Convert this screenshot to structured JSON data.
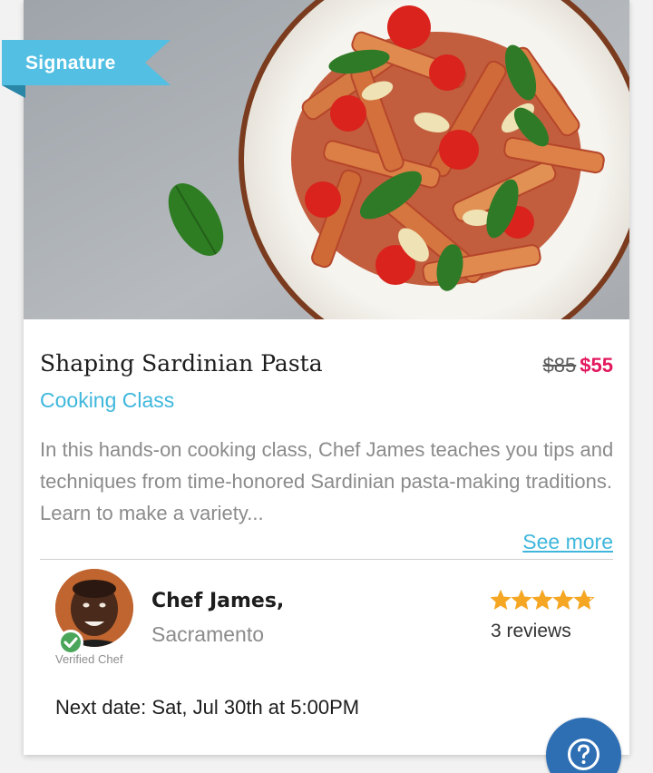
{
  "badge": {
    "label": "Signature",
    "color": "#52bfe3"
  },
  "listing": {
    "title": "Shaping Sardinian Pasta",
    "category": "Cooking Class",
    "price_original": "$85",
    "price_current": "$55",
    "description": "In this hands-on cooking class, Chef James teaches you tips and techniques from time-honored Sardinian pasta-making traditions. Learn to make a variety...",
    "see_more_label": "See more",
    "next_date": "Next date: Sat, Jul 30th at 5:00PM"
  },
  "chef": {
    "name": "Chef James,",
    "city": "Sacramento",
    "verified_label": "Verified Chef",
    "rating": 4.8,
    "rating_max": 5,
    "reviews_label": "3 reviews"
  },
  "icons": {
    "verified": "check-icon",
    "rating": "star-icon",
    "help": "question-mark-icon"
  },
  "colors": {
    "accent": "#3fb7dc",
    "price_sale": "#e3185f",
    "star": "#f5a623",
    "help_button": "#2e6fb4",
    "verified": "#4aa65a"
  }
}
